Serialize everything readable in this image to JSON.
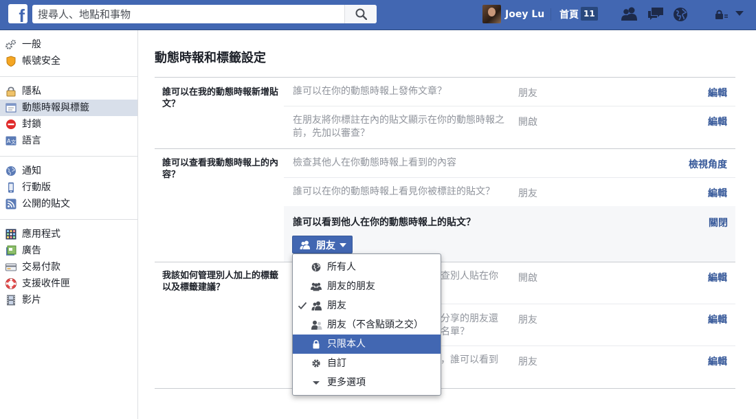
{
  "topbar": {
    "logo": "f",
    "search_placeholder": "搜尋人、地點和事物",
    "profile_name": "Joey Lu",
    "home_label": "首頁",
    "home_count": "11",
    "icons": [
      "friend-requests-icon",
      "messages-icon",
      "notifications-globe-icon",
      "privacy-shortcuts-icon",
      "account-menu-caret-icon"
    ],
    "brand_color": "#4267b2"
  },
  "sidebar": {
    "groups": [
      [
        {
          "label": "一般",
          "icon": "gears-icon"
        },
        {
          "label": "帳號安全",
          "icon": "security-badge-icon"
        }
      ],
      [
        {
          "label": "隱私",
          "icon": "privacy-lock-icon"
        },
        {
          "label": "動態時報與標籤",
          "icon": "timeline-icon",
          "active": true
        },
        {
          "label": "封鎖",
          "icon": "block-icon"
        },
        {
          "label": "語言",
          "icon": "language-icon"
        }
      ],
      [
        {
          "label": "通知",
          "icon": "globe-icon"
        },
        {
          "label": "行動版",
          "icon": "mobile-icon"
        },
        {
          "label": "公開的貼文",
          "icon": "rss-icon"
        }
      ],
      [
        {
          "label": "應用程式",
          "icon": "apps-icon"
        },
        {
          "label": "廣告",
          "icon": "ads-icon"
        },
        {
          "label": "交易付款",
          "icon": "payments-icon"
        },
        {
          "label": "支援收件匣",
          "icon": "support-lifebuoy-icon"
        },
        {
          "label": "影片",
          "icon": "video-film-icon"
        }
      ]
    ]
  },
  "main": {
    "title": "動態時報和標籤設定",
    "sections": [
      {
        "label": "誰可以在我的動態時報新增貼文？",
        "rows": [
          {
            "question": "誰可以在你的動態時報上發佈文章？",
            "value": "朋友",
            "action": "編輯"
          },
          {
            "question": "在朋友將你標註在內的貼文顯示在你的動態時報之前，先加以審查？",
            "value": "開啟",
            "action": "編輯"
          }
        ]
      },
      {
        "label": "誰可以查看我動態時報上的內容？",
        "rows": [
          {
            "question": "檢查其他人在你動態時報上看到的內容",
            "value": "",
            "action": "檢視角度"
          },
          {
            "question": "誰可以在你的動態時報上看見你被標註的貼文？",
            "value": "朋友",
            "action": "編輯"
          }
        ],
        "expanded": {
          "question": "誰可以看到他人在你的動態時報上的貼文？",
          "close": "關閉",
          "button_label": "朋友"
        }
      },
      {
        "label": "我該如何管理別人加上的標籤以及標籤建議？",
        "rows": [
          {
            "question": "查別人貼在你",
            "value": "開啟",
            "action": "編輯"
          },
          {
            "question": "分享的朋友還",
            "question2": "名單？",
            "value": "朋友",
            "action": "編輯"
          },
          {
            "question": "，誰可以看到",
            "value": "朋友",
            "action": "編輯"
          }
        ]
      }
    ]
  },
  "dropdown": {
    "items": [
      {
        "label": "所有人",
        "icon": "globe-icon"
      },
      {
        "label": "朋友的朋友",
        "icon": "friends-of-friends-icon"
      },
      {
        "label": "朋友",
        "icon": "friends-icon",
        "checked": true
      },
      {
        "label": "朋友（不含點頭之交）",
        "icon": "friends-except-icon"
      },
      {
        "label": "只限本人",
        "icon": "lock-icon",
        "highlighted": true
      },
      {
        "label": "自訂",
        "icon": "gear-icon"
      },
      {
        "label": "更多選項",
        "icon": "caret-down-icon"
      }
    ]
  }
}
